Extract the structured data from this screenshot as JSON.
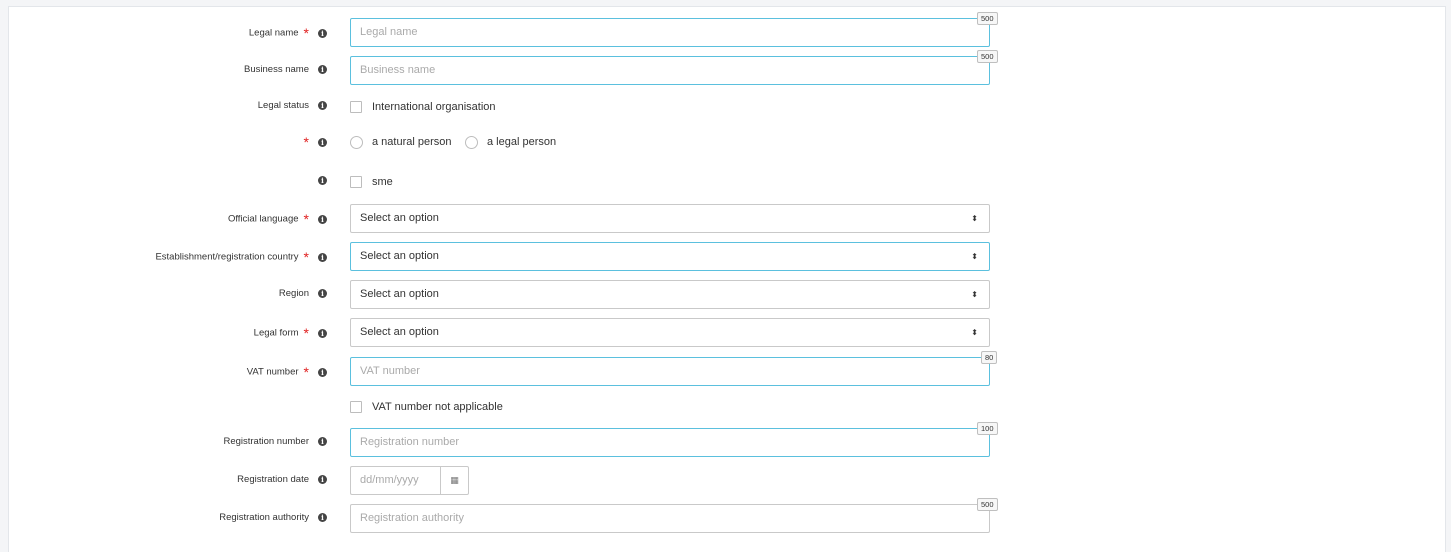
{
  "form": {
    "legal_name": {
      "label": "Legal name",
      "placeholder": "Legal name",
      "max": "500"
    },
    "business_name": {
      "label": "Business name",
      "placeholder": "Business name",
      "max": "500"
    },
    "legal_status": {
      "label": "Legal status",
      "option": "International organisation"
    },
    "person_type": {
      "natural": "a natural person",
      "legal": "a legal person"
    },
    "sme": {
      "option": "sme"
    },
    "official_language": {
      "label": "Official language",
      "value": "Select an option"
    },
    "country": {
      "label": "Establishment/registration country",
      "value": "Select an option"
    },
    "region": {
      "label": "Region",
      "value": "Select an option"
    },
    "legal_form": {
      "label": "Legal form",
      "value": "Select an option"
    },
    "vat_number": {
      "label": "VAT number",
      "placeholder": "VAT number",
      "max": "80"
    },
    "vat_na": {
      "option": "VAT number not applicable"
    },
    "registration_number": {
      "label": "Registration number",
      "placeholder": "Registration number",
      "max": "100"
    },
    "registration_date": {
      "label": "Registration date",
      "placeholder": "dd/mm/yyyy"
    },
    "registration_authority": {
      "label": "Registration authority",
      "placeholder": "Registration authority",
      "max": "500"
    }
  },
  "symbols": {
    "required": "*",
    "info": "i",
    "select_arrow": "⬍",
    "calendar": "▦"
  },
  "icons": {
    "info": "info-circle-icon",
    "select": "sort-icon",
    "calendar": "calendar-icon"
  },
  "colors": {
    "required": "#e02020",
    "focus_border": "#5bc0de"
  }
}
